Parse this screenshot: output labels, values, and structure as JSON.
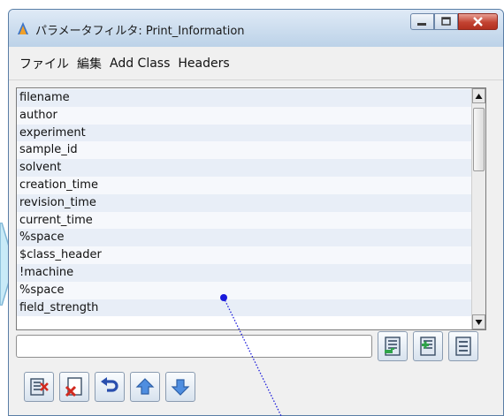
{
  "window": {
    "title": "パラメータフィルタ: Print_Information",
    "app_icon": "app-flame-icon"
  },
  "menu": {
    "items": [
      "ファイル",
      "編集",
      "Add Class",
      "Headers"
    ]
  },
  "list": {
    "items": [
      "filename",
      "author",
      "experiment",
      "sample_id",
      "solvent",
      "creation_time",
      "revision_time",
      "current_time",
      "%space",
      "$class_header",
      "!machine",
      "%space",
      "field_strength"
    ]
  },
  "input": {
    "value": ""
  },
  "icons": {
    "right_tools": [
      "insert-after-icon",
      "insert-before-icon",
      "list-lines-icon"
    ],
    "bottom_tools": [
      "delete-item-icon",
      "clear-icon",
      "undo-icon",
      "move-up-icon",
      "move-down-icon"
    ]
  },
  "colors": {
    "list_odd_row": "#e8eef7",
    "list_even_row": "#f6f8fc",
    "annotation_line": "#1a1adb",
    "close_button": "#c24332"
  }
}
